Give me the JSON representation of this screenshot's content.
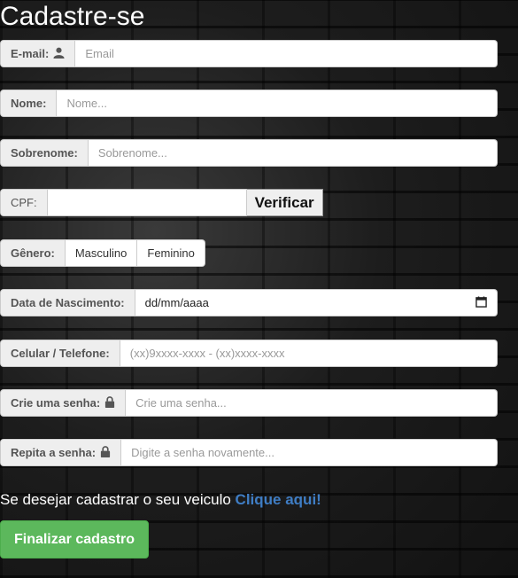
{
  "page": {
    "title": "Cadastre-se"
  },
  "form": {
    "email": {
      "label": "E-mail:",
      "icon": "user-icon",
      "placeholder": "Email"
    },
    "nome": {
      "label": "Nome:",
      "placeholder": "Nome..."
    },
    "sobrenome": {
      "label": "Sobrenome:",
      "placeholder": "Sobrenome..."
    },
    "cpf": {
      "label": "CPF:",
      "button": "Verificar"
    },
    "genero": {
      "label": "Gênero:",
      "options": [
        "Masculino",
        "Feminino"
      ]
    },
    "nascimento": {
      "label": "Data de Nascimento:",
      "value": "dd/mm/aaaa",
      "icon": "calendar-icon"
    },
    "celular": {
      "label": "Celular / Telefone:",
      "placeholder": "(xx)9xxxx-xxxx - (xx)xxxx-xxxx"
    },
    "senha": {
      "label": "Crie uma senha:",
      "icon": "lock-icon",
      "placeholder": "Crie uma senha..."
    },
    "repita": {
      "label": "Repita a senha:",
      "icon": "lock-icon",
      "placeholder": "Digite a senha novamente..."
    }
  },
  "vehicle": {
    "text": "Se desejar cadastrar o seu veiculo",
    "link": "Clique aqui!"
  },
  "submit": {
    "label": "Finalizar cadastro"
  },
  "colors": {
    "accent_green": "#5cb85c",
    "link_blue": "#3f7dc4"
  }
}
